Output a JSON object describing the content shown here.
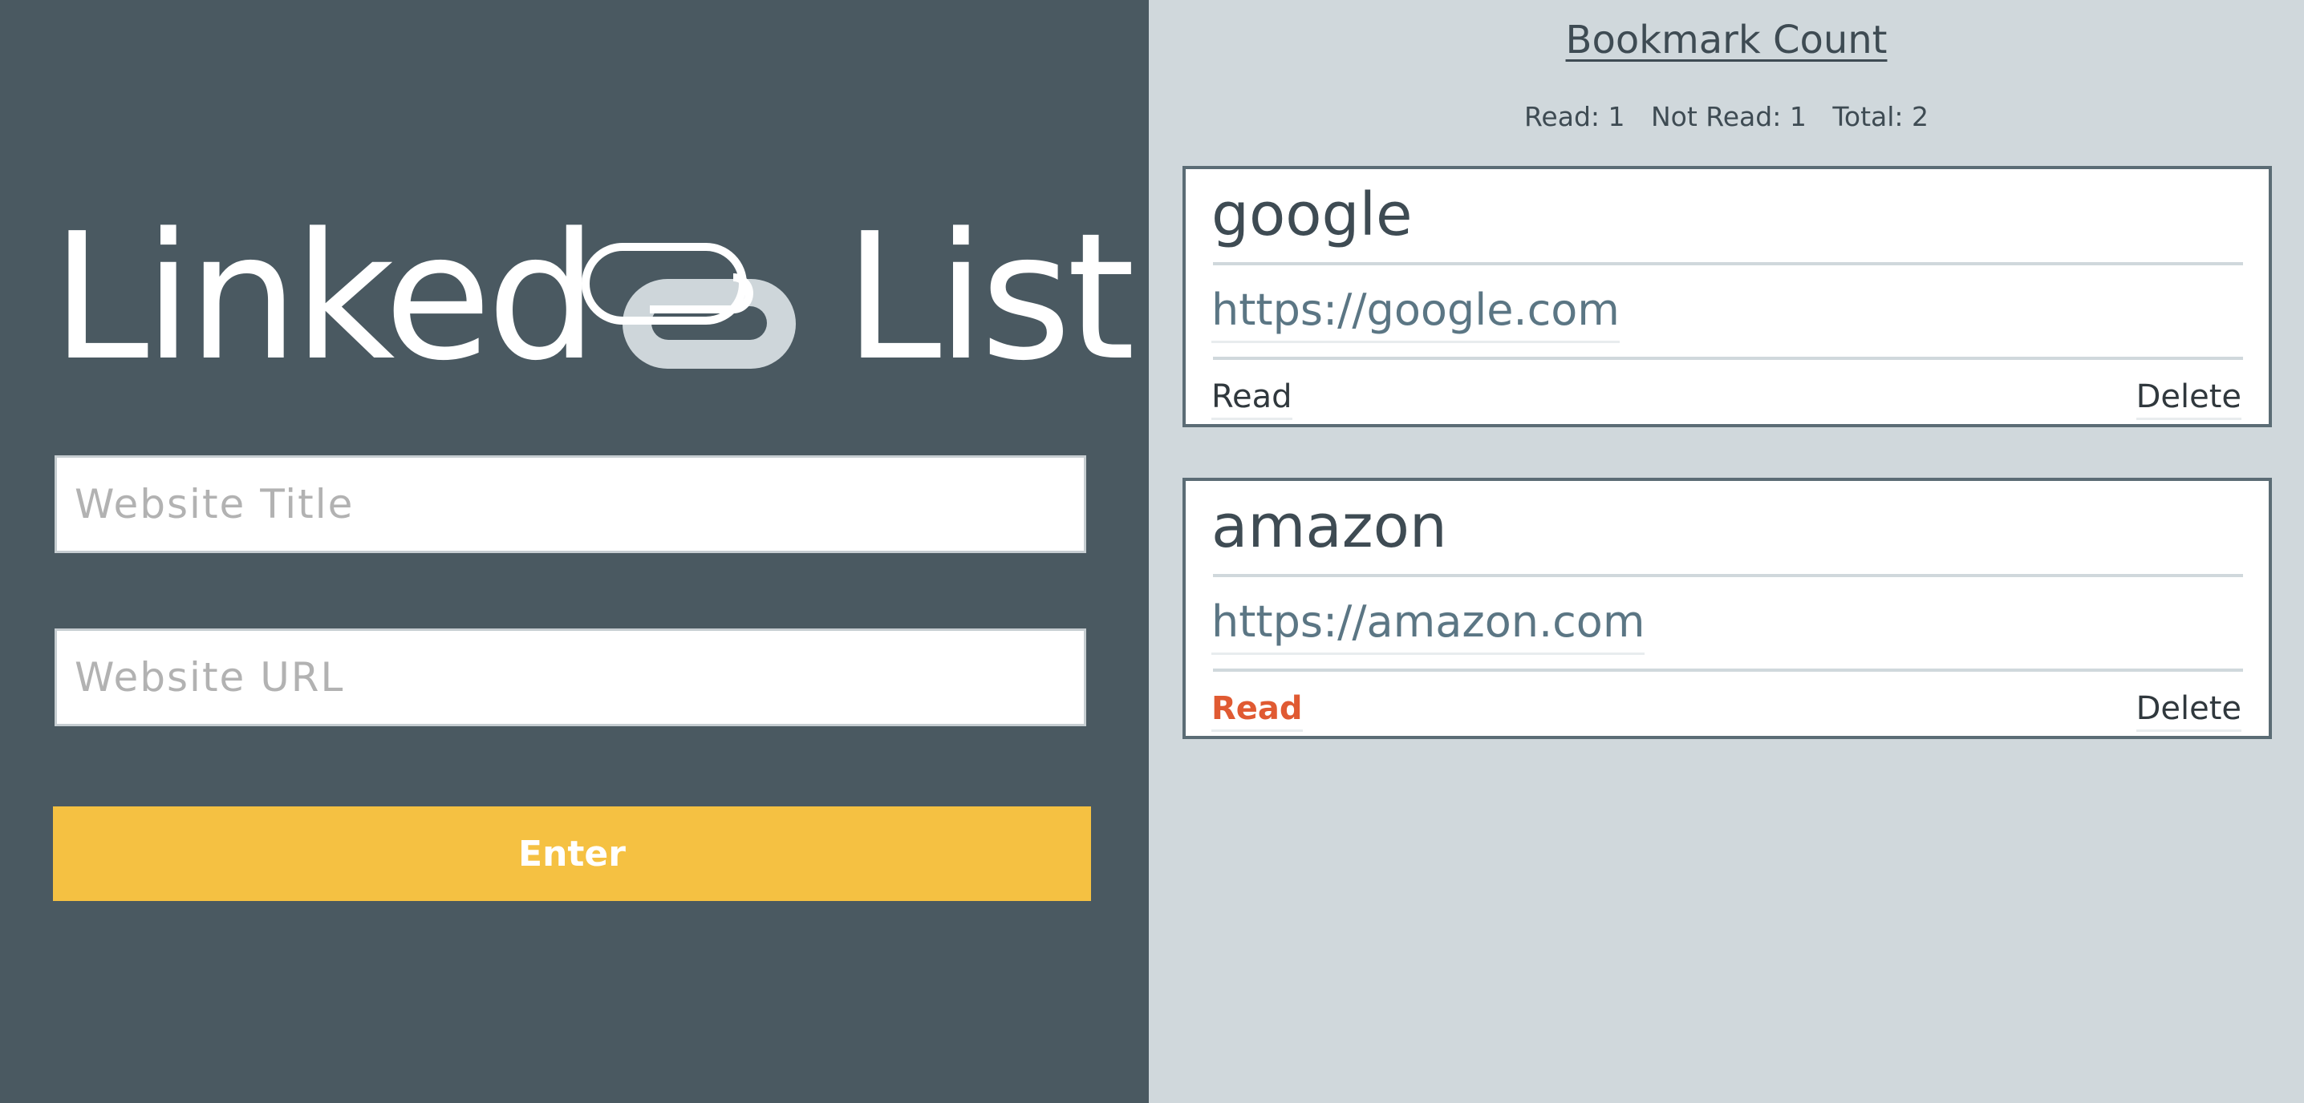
{
  "brand": {
    "title_left": "Linked",
    "title_right": "List",
    "icon": "paperclip-link-icon"
  },
  "form": {
    "title_placeholder": "Website Title",
    "url_placeholder": "Website URL",
    "title_value": "",
    "url_value": "",
    "enter_label": "Enter"
  },
  "counts": {
    "heading": "Bookmark Count",
    "read": "Read: 1",
    "not_read": "Not Read: 1",
    "total": "Total: 2"
  },
  "bookmarks": [
    {
      "title": "google",
      "url": "https://google.com",
      "read_label": "Read",
      "delete_label": "Delete",
      "is_read": false
    },
    {
      "title": "amazon",
      "url": "https://amazon.com",
      "read_label": "Read",
      "delete_label": "Delete",
      "is_read": true
    }
  ],
  "colors": {
    "left_background": "#4a5961",
    "right_background": "#d0d8dc",
    "enter_button": "#f5c142",
    "read_active": "#e05a32"
  }
}
